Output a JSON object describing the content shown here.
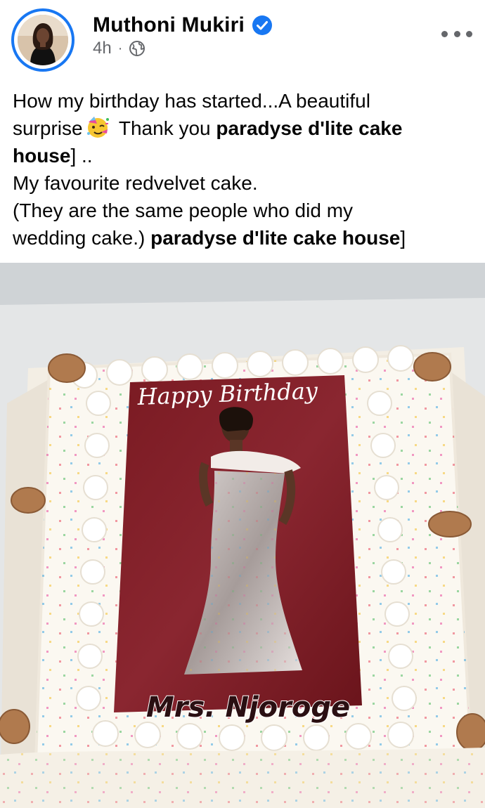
{
  "post": {
    "author": "Muthoni  Mukiri",
    "timestamp": "4h",
    "separator": "·",
    "audience_icon": "globe-icon",
    "verified_icon": "verified-badge-icon",
    "more_icon": "more-options-icon",
    "colors": {
      "accent": "#1877f2",
      "meta": "#65676b",
      "text": "#050505"
    },
    "caption": {
      "line1": "How my birthday has started...A beautiful",
      "line2_pre": "surprise",
      "line2_emoji": "partying-face-emoji",
      "line2_post": " Thank you ",
      "line2_bold": "paradyse d'lite cake",
      "line3_bold": "house",
      "line3_post": "] ..",
      "line4": "My favourite redvelvet cake.",
      "line5": "(They are the same people who did my",
      "line6_pre": "wedding cake.)  ",
      "line6_bold": "paradyse d'lite cake house",
      "line6_post": "]"
    },
    "photo": {
      "cake_topper_top": "Happy Birthday",
      "cake_topper_bottom": "Mrs. Njoroge"
    }
  }
}
